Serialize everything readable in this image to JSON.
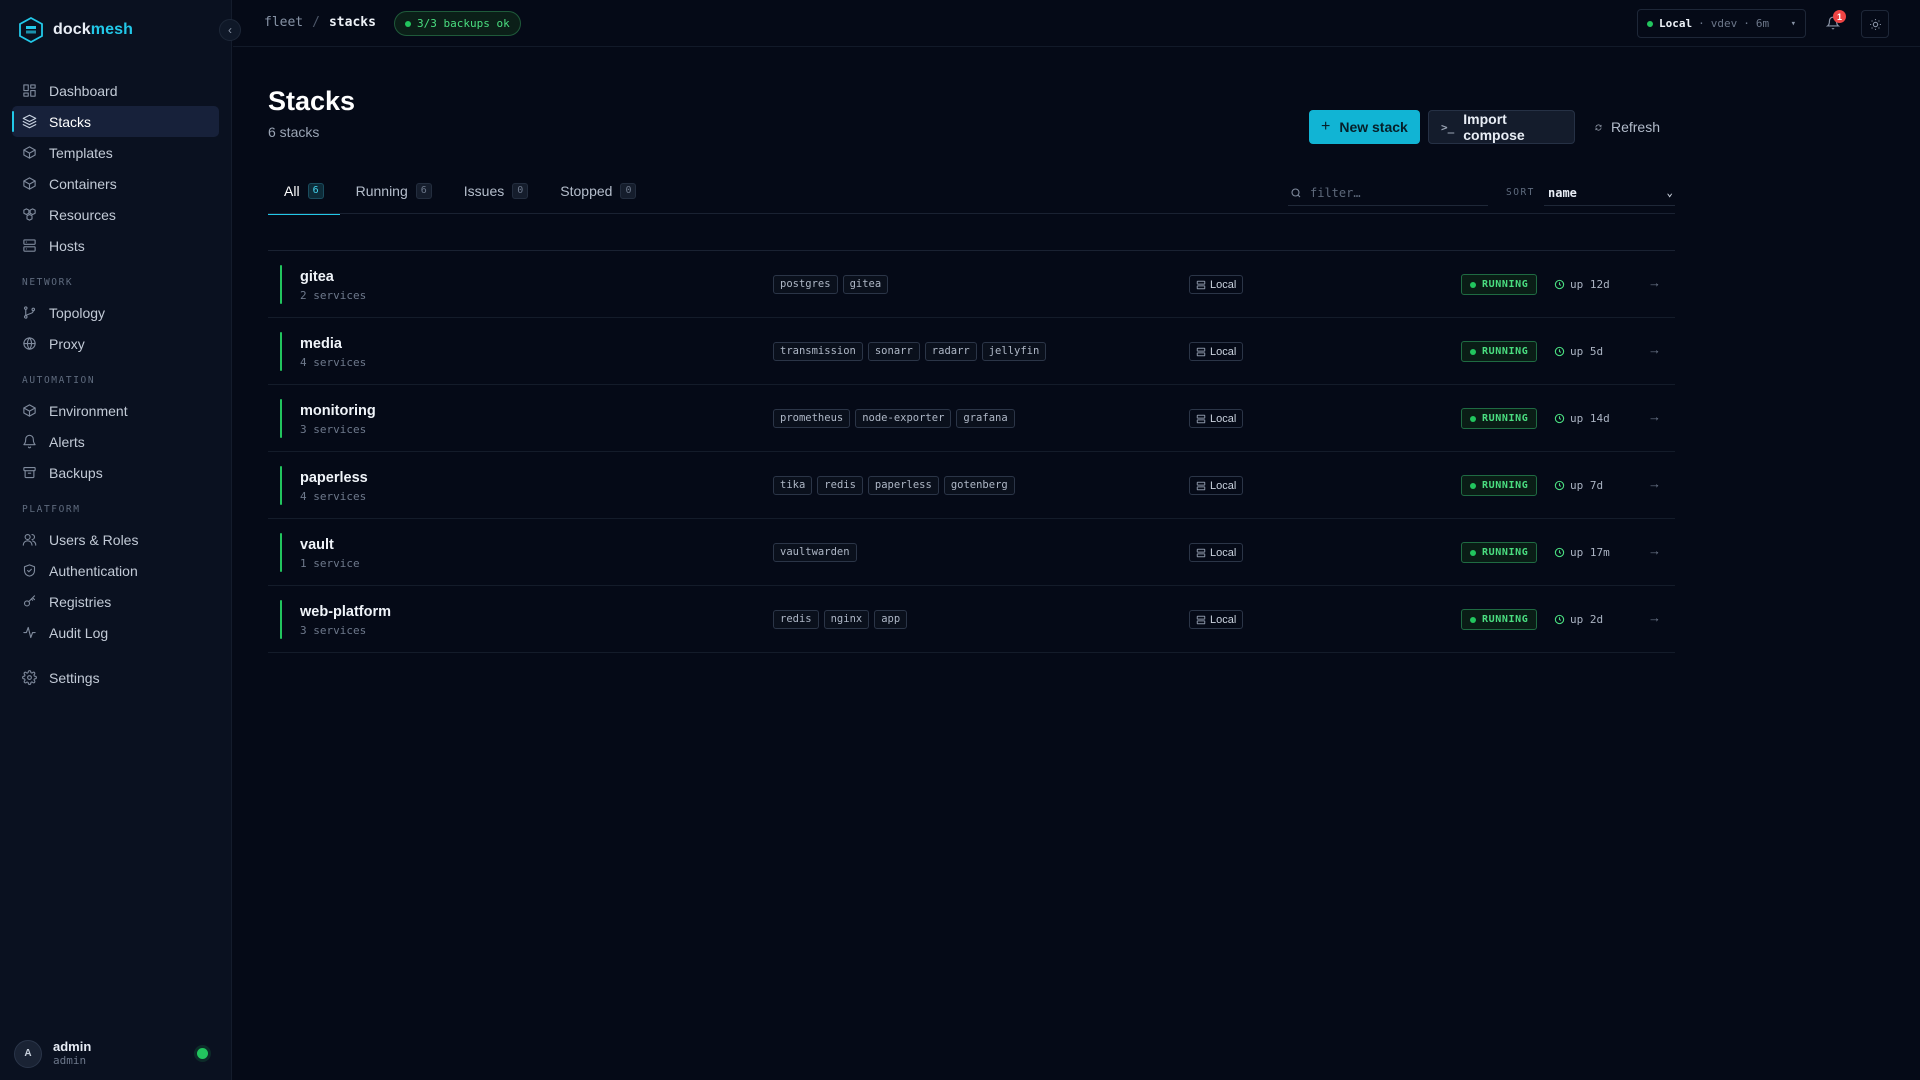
{
  "brand": {
    "prefix": "dock",
    "suffix": "mesh"
  },
  "sidebar": {
    "items_main": [
      {
        "label": "Dashboard",
        "icon": "dashboard-icon"
      },
      {
        "label": "Stacks",
        "icon": "layers-icon",
        "active": true
      },
      {
        "label": "Templates",
        "icon": "package-icon"
      },
      {
        "label": "Containers",
        "icon": "box-icon"
      },
      {
        "label": "Resources",
        "icon": "boxes-icon"
      },
      {
        "label": "Hosts",
        "icon": "server-icon"
      }
    ],
    "section_network": "NETWORK",
    "items_network": [
      {
        "label": "Topology",
        "icon": "git-branch-icon"
      },
      {
        "label": "Proxy",
        "icon": "globe-icon"
      }
    ],
    "section_automation": "AUTOMATION",
    "items_automation": [
      {
        "label": "Environment",
        "icon": "cube-icon"
      },
      {
        "label": "Alerts",
        "icon": "bell-icon"
      },
      {
        "label": "Backups",
        "icon": "archive-icon"
      }
    ],
    "section_platform": "PLATFORM",
    "items_platform": [
      {
        "label": "Users & Roles",
        "icon": "users-icon"
      },
      {
        "label": "Authentication",
        "icon": "shield-icon"
      },
      {
        "label": "Registries",
        "icon": "key-icon"
      },
      {
        "label": "Audit Log",
        "icon": "activity-icon"
      }
    ],
    "settings": {
      "label": "Settings",
      "icon": "gear-icon"
    },
    "user": {
      "initial": "A",
      "name": "admin",
      "role": "admin"
    }
  },
  "topbar": {
    "breadcrumb": [
      "fleet",
      "stacks"
    ],
    "backup_status": "3/3 backups ok",
    "host": {
      "name": "Local",
      "version": "vdev",
      "age": "6m"
    },
    "notifications": "1"
  },
  "page": {
    "title": "Stacks",
    "subtitle": "6 stacks",
    "new_stack": "New stack",
    "import_compose": "Import compose",
    "refresh": "Refresh"
  },
  "tabs": [
    {
      "label": "All",
      "count": "6",
      "active": true
    },
    {
      "label": "Running",
      "count": "6"
    },
    {
      "label": "Issues",
      "count": "0"
    },
    {
      "label": "Stopped",
      "count": "0"
    }
  ],
  "filter": {
    "placeholder": "filter…"
  },
  "sort": {
    "label": "SORT",
    "value": "name"
  },
  "stacks": [
    {
      "name": "gitea",
      "services": "2 services",
      "tags": [
        "postgres",
        "gitea"
      ],
      "host": "Local",
      "status": "RUNNING",
      "uptime": "up 12d"
    },
    {
      "name": "media",
      "services": "4 services",
      "tags": [
        "transmission",
        "sonarr",
        "radarr",
        "jellyfin"
      ],
      "host": "Local",
      "status": "RUNNING",
      "uptime": "up 5d"
    },
    {
      "name": "monitoring",
      "services": "3 services",
      "tags": [
        "prometheus",
        "node-exporter",
        "grafana"
      ],
      "host": "Local",
      "status": "RUNNING",
      "uptime": "up 14d"
    },
    {
      "name": "paperless",
      "services": "4 services",
      "tags": [
        "tika",
        "redis",
        "paperless",
        "gotenberg"
      ],
      "host": "Local",
      "status": "RUNNING",
      "uptime": "up 7d"
    },
    {
      "name": "vault",
      "services": "1 service",
      "tags": [
        "vaultwarden"
      ],
      "host": "Local",
      "status": "RUNNING",
      "uptime": "up 17m"
    },
    {
      "name": "web-platform",
      "services": "3 services",
      "tags": [
        "redis",
        "nginx",
        "app"
      ],
      "host": "Local",
      "status": "RUNNING",
      "uptime": "up 2d"
    }
  ],
  "colors": {
    "accent": "#22c8e8",
    "running": "#22c55e",
    "background": "#050a17"
  }
}
